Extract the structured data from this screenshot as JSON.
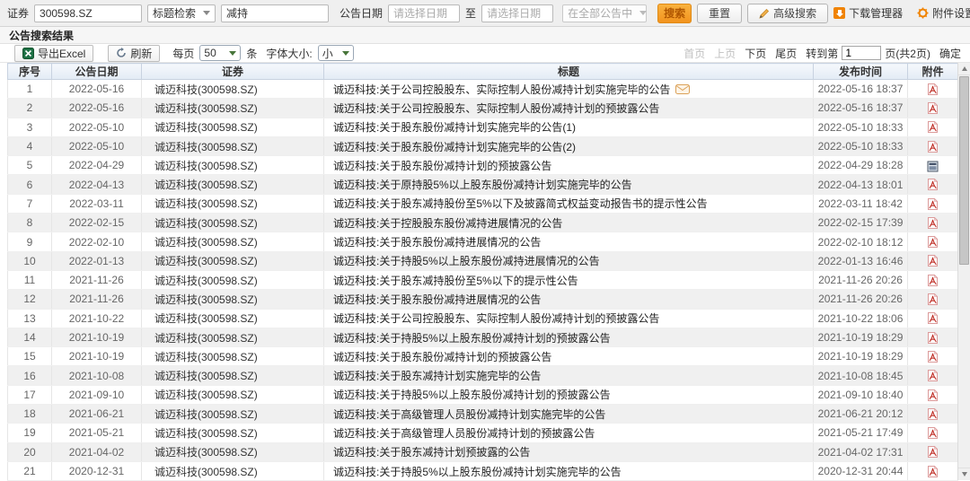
{
  "filter": {
    "security_label": "证券",
    "security_value": "300598.SZ",
    "title_search_label": "标题检索",
    "keyword_value": "减持",
    "date_label": "公告日期",
    "date_from_placeholder": "请选择日期",
    "to_label": "至",
    "date_to_placeholder": "请选择日期",
    "scope_value": "在全部公告中",
    "search_button": "搜索",
    "reset_button": "重置",
    "advanced_search": "高级搜索",
    "download_manager": "下载管理器",
    "attachment_settings": "附件设置"
  },
  "section_title": "公告搜索结果",
  "toolbar": {
    "export_excel": "导出Excel",
    "refresh": "刷新",
    "per_page_label": "每页",
    "per_page_value": "50",
    "per_page_unit": "条",
    "font_size_label": "字体大小:",
    "font_size_value": "小",
    "pagination": {
      "first": "首页",
      "prev": "上页",
      "next": "下页",
      "last": "尾页",
      "goto_prefix": "转到第",
      "page_value": "1",
      "goto_suffix": "页(共2页)",
      "confirm": "确定"
    }
  },
  "table": {
    "headers": [
      "序号",
      "公告日期",
      "证券",
      "标题",
      "发布时间",
      "附件"
    ],
    "rows": [
      {
        "no": "1",
        "date": "2022-05-16",
        "security": "诚迈科技(300598.SZ)",
        "title": "诚迈科技:关于公司控股股东、实际控制人股份减持计划实施完毕的公告",
        "title_icon": "mail-icon",
        "time": "2022-05-16 18:37",
        "attachment": "pdf-icon"
      },
      {
        "no": "2",
        "date": "2022-05-16",
        "security": "诚迈科技(300598.SZ)",
        "title": "诚迈科技:关于公司控股股东、实际控制人股份减持计划的预披露公告",
        "time": "2022-05-16 18:37",
        "attachment": "pdf-icon"
      },
      {
        "no": "3",
        "date": "2022-05-10",
        "security": "诚迈科技(300598.SZ)",
        "title": "诚迈科技:关于股东股份减持计划实施完毕的公告(1)",
        "time": "2022-05-10 18:33",
        "attachment": "pdf-icon"
      },
      {
        "no": "4",
        "date": "2022-05-10",
        "security": "诚迈科技(300598.SZ)",
        "title": "诚迈科技:关于股东股份减持计划实施完毕的公告(2)",
        "time": "2022-05-10 18:33",
        "attachment": "pdf-icon"
      },
      {
        "no": "5",
        "date": "2022-04-29",
        "security": "诚迈科技(300598.SZ)",
        "title": "诚迈科技:关于股东股份减持计划的预披露公告",
        "time": "2022-04-29 18:28",
        "attachment": "doc-icon"
      },
      {
        "no": "6",
        "date": "2022-04-13",
        "security": "诚迈科技(300598.SZ)",
        "title": "诚迈科技:关于原持股5%以上股东股份减持计划实施完毕的公告",
        "time": "2022-04-13 18:01",
        "attachment": "pdf-icon"
      },
      {
        "no": "7",
        "date": "2022-03-11",
        "security": "诚迈科技(300598.SZ)",
        "title": "诚迈科技:关于股东减持股份至5%以下及披露简式权益变动报告书的提示性公告",
        "time": "2022-03-11 18:42",
        "attachment": "pdf-icon"
      },
      {
        "no": "8",
        "date": "2022-02-15",
        "security": "诚迈科技(300598.SZ)",
        "title": "诚迈科技:关于控股股东股份减持进展情况的公告",
        "time": "2022-02-15 17:39",
        "attachment": "pdf-icon"
      },
      {
        "no": "9",
        "date": "2022-02-10",
        "security": "诚迈科技(300598.SZ)",
        "title": "诚迈科技:关于股东股份减持进展情况的公告",
        "time": "2022-02-10 18:12",
        "attachment": "pdf-icon"
      },
      {
        "no": "10",
        "date": "2022-01-13",
        "security": "诚迈科技(300598.SZ)",
        "title": "诚迈科技:关于持股5%以上股东股份减持进展情况的公告",
        "time": "2022-01-13 16:46",
        "attachment": "pdf-icon"
      },
      {
        "no": "11",
        "date": "2021-11-26",
        "security": "诚迈科技(300598.SZ)",
        "title": "诚迈科技:关于股东减持股份至5%以下的提示性公告",
        "time": "2021-11-26 20:26",
        "attachment": "pdf-icon"
      },
      {
        "no": "12",
        "date": "2021-11-26",
        "security": "诚迈科技(300598.SZ)",
        "title": "诚迈科技:关于股东股份减持进展情况的公告",
        "time": "2021-11-26 20:26",
        "attachment": "pdf-icon"
      },
      {
        "no": "13",
        "date": "2021-10-22",
        "security": "诚迈科技(300598.SZ)",
        "title": "诚迈科技:关于公司控股股东、实际控制人股份减持计划的预披露公告",
        "time": "2021-10-22 18:06",
        "attachment": "pdf-icon"
      },
      {
        "no": "14",
        "date": "2021-10-19",
        "security": "诚迈科技(300598.SZ)",
        "title": "诚迈科技:关于持股5%以上股东股份减持计划的预披露公告",
        "time": "2021-10-19 18:29",
        "attachment": "pdf-icon"
      },
      {
        "no": "15",
        "date": "2021-10-19",
        "security": "诚迈科技(300598.SZ)",
        "title": "诚迈科技:关于股东股份减持计划的预披露公告",
        "time": "2021-10-19 18:29",
        "attachment": "pdf-icon"
      },
      {
        "no": "16",
        "date": "2021-10-08",
        "security": "诚迈科技(300598.SZ)",
        "title": "诚迈科技:关于股东减持计划实施完毕的公告",
        "time": "2021-10-08 18:45",
        "attachment": "pdf-icon"
      },
      {
        "no": "17",
        "date": "2021-09-10",
        "security": "诚迈科技(300598.SZ)",
        "title": "诚迈科技:关于持股5%以上股东股份减持计划的预披露公告",
        "time": "2021-09-10 18:40",
        "attachment": "pdf-icon"
      },
      {
        "no": "18",
        "date": "2021-06-21",
        "security": "诚迈科技(300598.SZ)",
        "title": "诚迈科技:关于高级管理人员股份减持计划实施完毕的公告",
        "time": "2021-06-21 20:12",
        "attachment": "pdf-icon"
      },
      {
        "no": "19",
        "date": "2021-05-21",
        "security": "诚迈科技(300598.SZ)",
        "title": "诚迈科技:关于高级管理人员股份减持计划的预披露公告",
        "time": "2021-05-21 17:49",
        "attachment": "pdf-icon"
      },
      {
        "no": "20",
        "date": "2021-04-02",
        "security": "诚迈科技(300598.SZ)",
        "title": "诚迈科技:关于股东减持计划预披露的公告",
        "time": "2021-04-02 17:31",
        "attachment": "pdf-icon"
      },
      {
        "no": "21",
        "date": "2020-12-31",
        "security": "诚迈科技(300598.SZ)",
        "title": "诚迈科技:关于持股5%以上股东股份减持计划实施完毕的公告",
        "time": "2020-12-31 20:44",
        "attachment": "pdf-icon"
      }
    ]
  },
  "colors": {
    "accent_orange": "#f2931e",
    "icon_orange": "#f08300",
    "pdf_red": "#c03028",
    "header_bg": "#e3ebf5",
    "stripe_gray": "#f0f0f0"
  }
}
